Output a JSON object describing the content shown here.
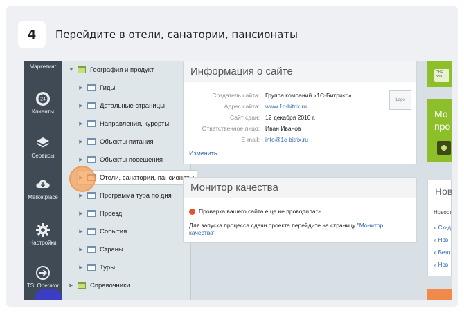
{
  "step": {
    "number": "4",
    "text": "Перейдите в отели, санатории, пансионаты"
  },
  "nav": {
    "items": [
      {
        "label": "Маркетинг",
        "icon": "marketing-icon"
      },
      {
        "label": "Клиенты",
        "icon": "clients-icon"
      },
      {
        "label": "Сервисы",
        "icon": "layers-icon"
      },
      {
        "label": "Marketplace",
        "icon": "cloud-download-icon"
      },
      {
        "label": "Настройки",
        "icon": "gear-icon"
      },
      {
        "label": "TS: Operator",
        "icon": "arrow-right-circle-icon"
      }
    ],
    "clients_badge": "24"
  },
  "tree": {
    "root": "География и продукт",
    "items": [
      "Гиды",
      "Детальные страницы",
      "Направления, курорты,",
      "Объекты питания",
      "Объекты посещения",
      "Отели, санатории, пансионаты",
      "Программа тура по дня",
      "Проезд",
      "События",
      "Страны",
      "Туры"
    ],
    "footer": "Справочники"
  },
  "info": {
    "title": "Информация о сайте",
    "rows": [
      {
        "label": "Создатель сайта:",
        "value": "Группа компаний «1С-Битрикс»."
      },
      {
        "label": "Адрес сайта:",
        "value": "www.1c-bitrix.ru"
      },
      {
        "label": "Сайт сдан:",
        "value": "12 декабря 2010 г."
      },
      {
        "label": "Ответственное лицо:",
        "value": "Иван Иванов"
      },
      {
        "label": "E-mail:",
        "value": "info@1c-bitrix.ru"
      }
    ],
    "logo": "Logo",
    "edit": "Изменить"
  },
  "monitor": {
    "title": "Монитор качества",
    "warning": "Проверка вашего сайта еще не проводилась",
    "hint_prefix": "Для запуска процесса сдачи проекта перейдите на страницу ",
    "hint_link": "\"Монитор качества\""
  },
  "right": {
    "green_top_text": "СНЕ БЫС",
    "green_mid_text": "Мо про",
    "news_title": "Нов",
    "news_sub": "Новост",
    "news_items": [
      "» Скид",
      "» Нов",
      "» Безо",
      "» Нов"
    ]
  },
  "colors": {
    "nav_bg": "#3f4a55",
    "accent_green": "#8cbf2a",
    "link": "#2d67b3"
  }
}
